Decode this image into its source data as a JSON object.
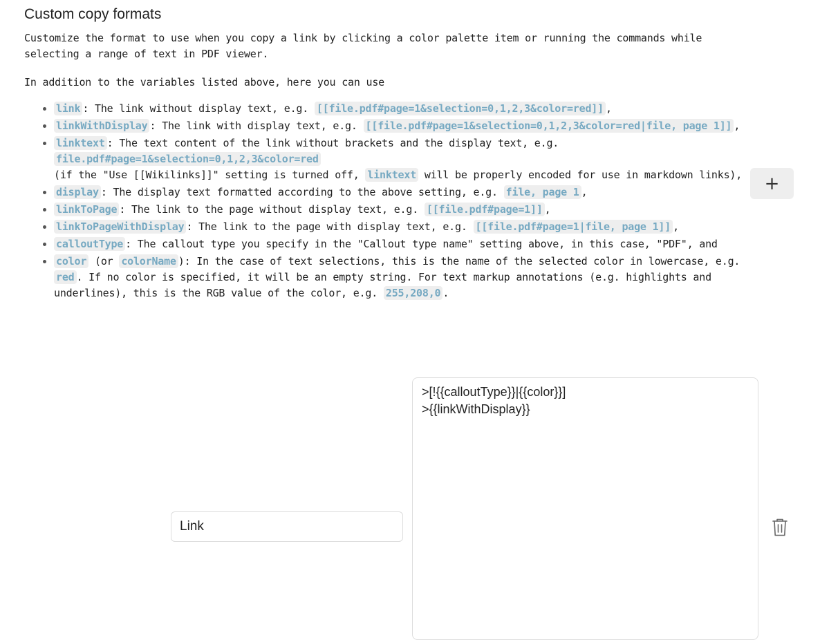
{
  "section": {
    "title": "Custom copy formats",
    "description": "Customize the format to use when you copy a link by clicking a color palette item or running the commands while selecting a range of text in PDF viewer.",
    "intro": "In addition to the variables listed above, here you can use"
  },
  "variables": [
    {
      "name": "link",
      "text": ": The link without display text, e.g. ",
      "example": "[[file.pdf#page=1&selection=0,1,2,3&color=red]]",
      "end": ","
    },
    {
      "name": "linkWithDisplay",
      "text": ": The link with display text, e.g. ",
      "example": "[[file.pdf#page=1&selection=0,1,2,3&color=red|file, page 1]]",
      "end": ","
    },
    {
      "name": "linktext",
      "text": ": The text content of the link without brackets and the display text, e.g. ",
      "example": "file.pdf#page=1&selection=0,1,2,3&color=red",
      "note_a": "(if the \"Use [[Wikilinks]]\" setting is turned off, ",
      "note_code": "linktext",
      "note_b": " will be properly encoded for use in markdown links),"
    },
    {
      "name": "display",
      "text": ": The display text formatted according to the above setting, e.g. ",
      "example": "file, page 1",
      "end": ","
    },
    {
      "name": "linkToPage",
      "text": ": The link to the page without display text, e.g. ",
      "example": "[[file.pdf#page=1]]",
      "end": ","
    },
    {
      "name": "linkToPageWithDisplay",
      "text": ": The link to the page with display text, e.g. ",
      "example": "[[file.pdf#page=1|file, page 1]]",
      "end": ","
    },
    {
      "name": "calloutType",
      "text": ": The callout type you specify in the \"Callout type name\" setting above, in this case, \"PDF\", and"
    },
    {
      "name": "color",
      "alt_a": " (or ",
      "alt_name": "colorName",
      "text": "): In the case of text selections, this is the name of the selected color in lowercase, e.g. ",
      "example": "red",
      "text2": ". If no color is specified, it will be an empty string. For text markup annotations (e.g. highlights and underlines), this is the RGB value of the color, e.g. ",
      "example2": "255,208,0",
      "end": "."
    }
  ],
  "add_button": {
    "label": "+"
  },
  "format": {
    "name": "Link",
    "template": ">[!{{calloutType}}|{{color}}]\n>{{linkWithDisplay}}"
  }
}
